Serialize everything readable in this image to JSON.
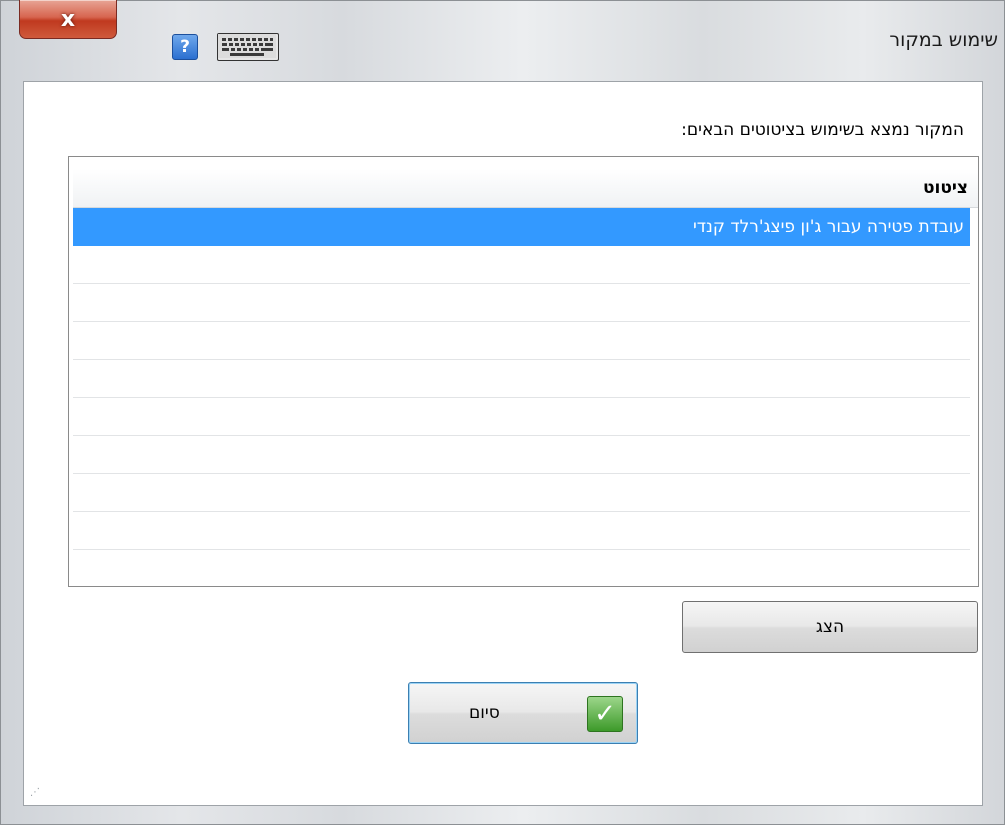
{
  "window": {
    "title": "שימוש במקור",
    "close_label": "x"
  },
  "icons": {
    "help": "?",
    "help_name": "help-icon",
    "keyboard_name": "keyboard-icon",
    "check": "✓",
    "grip": "⋰"
  },
  "main": {
    "instruction": "המקור נמצא בשימוש בציטוטים הבאים:",
    "list": {
      "column_header": "ציטוט",
      "rows": [
        "עובדת פטירה עבור ג'ון פיצג'רלד קנדי",
        "",
        "",
        "",
        "",
        "",
        "",
        "",
        "",
        ""
      ],
      "selected_index": 0
    },
    "show_button": "הצג",
    "finish_button": "סיום"
  },
  "colors": {
    "selection": "#3399ff",
    "close_button": "#c0391f",
    "check_green": "#3d9a2a"
  }
}
